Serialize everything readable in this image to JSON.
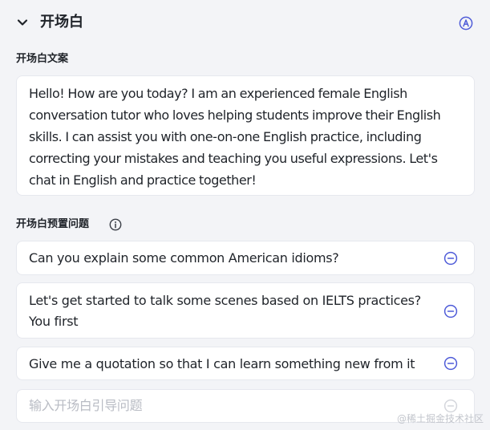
{
  "header": {
    "title": "开场白",
    "chevron_icon": "chevron-down-icon",
    "auto_icon": "auto-a-circle-icon",
    "accent_color": "#4e5bd8"
  },
  "opening": {
    "label": "开场白文案",
    "text": "Hello! How are you today? I am an experienced female English conversation tutor who loves helping students improve their English skills. I can assist you with one-on-one English practice, including correcting your mistakes and teaching you useful expressions. Let's chat in English and practice together!"
  },
  "questions": {
    "label": "开场白预置问题",
    "info_icon": "info-circle-icon",
    "items": [
      {
        "text": "Can you explain some common American idioms?",
        "icon": "remove-circle-icon"
      },
      {
        "text": "Let's get started to talk some scenes based on IELTS practices? You first",
        "icon": "remove-circle-icon"
      },
      {
        "text": "Give me a quotation so that I can learn something new from it",
        "icon": "remove-circle-icon"
      }
    ],
    "input_placeholder": "输入开场白引导问题"
  },
  "watermark": "@稀土掘金技术社区"
}
